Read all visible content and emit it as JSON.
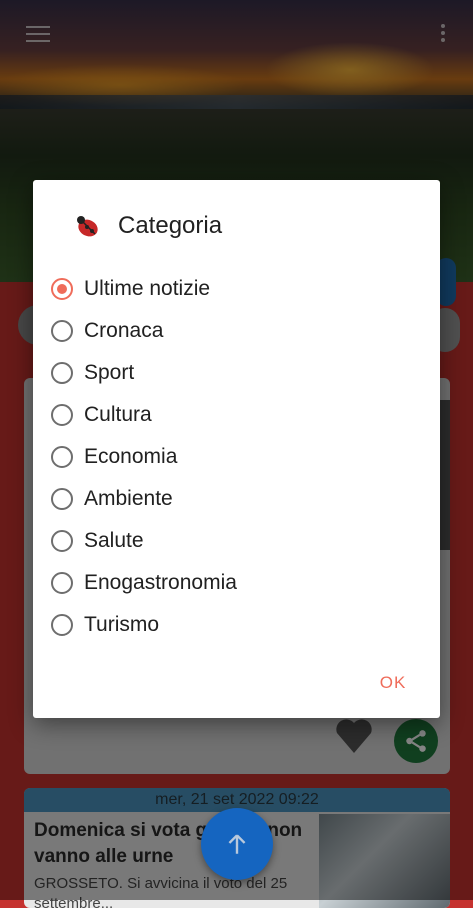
{
  "dialog": {
    "title": "Categoria",
    "options": [
      {
        "label": "Ultime notizie",
        "checked": true
      },
      {
        "label": "Cronaca",
        "checked": false
      },
      {
        "label": "Sport",
        "checked": false
      },
      {
        "label": "Cultura",
        "checked": false
      },
      {
        "label": "Economia",
        "checked": false
      },
      {
        "label": "Ambiente",
        "checked": false
      },
      {
        "label": "Salute",
        "checked": false
      },
      {
        "label": "Enogastronomia",
        "checked": false
      },
      {
        "label": "Turismo",
        "checked": false
      }
    ],
    "ok_label": "OK"
  },
  "card2": {
    "date": "mer, 21 set 2022 09:22",
    "title": "Domenica si vota giovani non vanno alle urne",
    "excerpt": "GROSSETO. Si avvicina il voto del 25 settembre..."
  },
  "colors": {
    "accent": "#ef6c5a",
    "fab": "#1565c0",
    "share": "#1f7a3c",
    "background": "#c5322f"
  },
  "icons": {
    "menu": "menu-icon",
    "more": "more-vert-icon",
    "heart": "heart-icon",
    "share": "share-icon",
    "fab": "arrow-up-icon",
    "dialog": "ladybug-logo-icon"
  }
}
